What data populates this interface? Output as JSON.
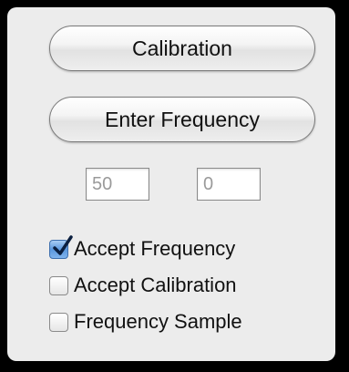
{
  "buttons": {
    "calibration": "Calibration",
    "enter_frequency": "Enter Frequency"
  },
  "fields": {
    "first_value": "50",
    "second_value": "0"
  },
  "checkboxes": [
    {
      "label": "Accept Frequency",
      "checked": true
    },
    {
      "label": "Accept Calibration",
      "checked": false
    },
    {
      "label": "Frequency Sample",
      "checked": false
    }
  ],
  "colors": {
    "window_frame": "#000000",
    "panel_background": "#ececec",
    "checkbox_accent": "#5b98de"
  }
}
